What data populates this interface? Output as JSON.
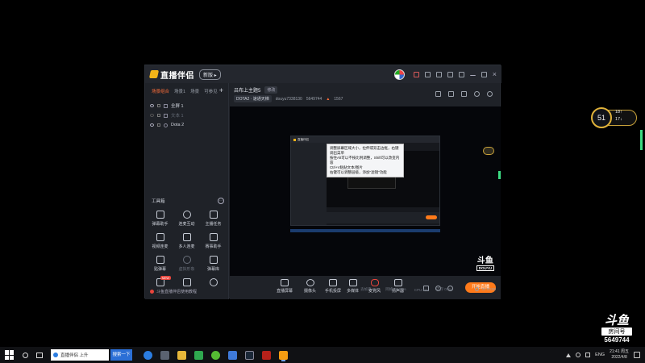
{
  "app": {
    "name": "直播伴侣",
    "version_badge": "新版 ▸",
    "scene_tabs": [
      "场景组合",
      "场景1",
      "场景",
      "可参见"
    ],
    "scenes": [
      {
        "label": "全屏 1",
        "dim": false
      },
      {
        "label": "文本 1",
        "dim": true
      },
      {
        "label": "Dota 2",
        "dim": false
      }
    ],
    "toolbox_title": "工具箱",
    "tools": [
      {
        "label": "弹幕助手",
        "dim": false
      },
      {
        "label": "连麦互动",
        "dim": false
      },
      {
        "label": "主播任务",
        "dim": false
      },
      {
        "label": "视频连麦",
        "dim": false
      },
      {
        "label": "多人连麦",
        "dim": false
      },
      {
        "label": "赛事助手",
        "dim": false
      },
      {
        "label": "贴弹幕",
        "dim": false
      },
      {
        "label": "虚拟形象",
        "dim": true
      },
      {
        "label": "弹幕库",
        "dim": false
      },
      {
        "label": "图片",
        "dim": false,
        "badge": "NEW"
      },
      {
        "label": "",
        "dim": false
      },
      {
        "label": "",
        "dim": false
      }
    ],
    "left_notice": "斗鱼直播伴侣使用教程"
  },
  "room": {
    "title": "吕布上主题5",
    "edit_label": "修改",
    "category": "DOTA2 · 速通天梯",
    "user_id": "douyu7338130",
    "room_number": "5649744",
    "popularity": "1567"
  },
  "preview": {
    "nested_title": "直播伴侣",
    "tooltip_lines": [
      "调整屏幕区域大小，拉伸或双击边框，右键调出菜单",
      "按住Alt可以不按比例调整，Shift可以改变内容",
      "Ctrl+V粘贴文本/图片",
      "右键可以调整层级，添加\"滤镜\"功能"
    ],
    "watermark_big": "斗鱼",
    "watermark_small": "DOUYU"
  },
  "controls": {
    "buttons": [
      "直播屏幕",
      "摄像头",
      "手机投屏",
      "多媒体",
      "麦克风",
      "扬声器"
    ],
    "live_button": "开始直播"
  },
  "status": {
    "items": [
      "丢帧率 0%",
      "网络 00.00%",
      "CPU 6%",
      "内存 00%"
    ],
    "rec_time": "00:00:00"
  },
  "gauge": {
    "percent": "51",
    "up": "18↑",
    "down": "17↓"
  },
  "desktop_watermark": {
    "logo": "斗鱼",
    "label": "房间号",
    "room": "5649744"
  },
  "taskbar": {
    "search_text": "直播伴侣 上升",
    "search_button": "搜索一下",
    "tray_lang": "ENG",
    "clock_time": "21:41 周五",
    "clock_date": "2022/4/8"
  },
  "colors": {
    "accent": "#ff7a1a",
    "gold": "#e0b23a"
  }
}
